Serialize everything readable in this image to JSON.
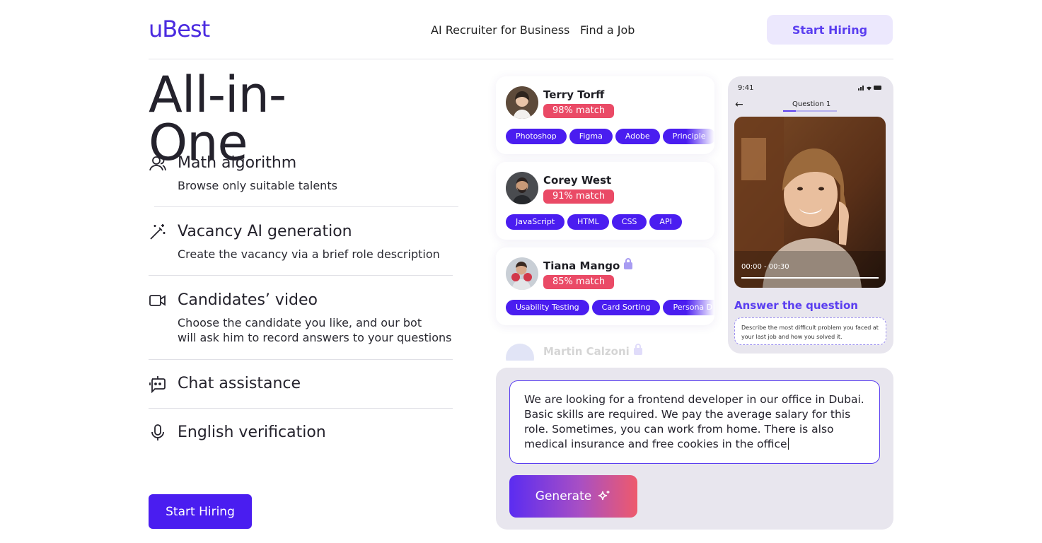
{
  "header": {
    "logo": "uBest",
    "nav": [
      "AI Recruiter for Business",
      "Find a Job"
    ],
    "cta": "Start Hiring"
  },
  "hero": {
    "title": "All-in-One"
  },
  "features": [
    {
      "icon": "user-icon",
      "title": "Math algorithm",
      "desc": [
        "Browse only suitable talents"
      ]
    },
    {
      "icon": "magic-wand-icon",
      "title": "Vacancy AI generation",
      "desc": [
        "Create the vacancy via a brief role description"
      ]
    },
    {
      "icon": "video-camera-icon",
      "title": "Candidates’ video",
      "desc": [
        "Choose the candidate you like, and our bot",
        "will ask him to record answers to your questions"
      ]
    },
    {
      "icon": "chat-bot-icon",
      "title": "Chat assistance",
      "desc": []
    },
    {
      "icon": "microphone-icon",
      "title": "English verification",
      "desc": []
    }
  ],
  "main_cta": "Start Hiring",
  "candidates": [
    {
      "name": "Terry Torff",
      "match": "98% match",
      "locked": false,
      "tags": [
        "Photoshop",
        "Figma",
        "Adobe",
        "Principle"
      ]
    },
    {
      "name": "Corey West",
      "match": "91% match",
      "locked": false,
      "tags": [
        "JavaScript",
        "HTML",
        "CSS",
        "API"
      ]
    },
    {
      "name": "Tiana Mango",
      "match": "85% match",
      "locked": true,
      "tags": [
        "Usability Testing",
        "Card Sorting",
        "Persona D"
      ]
    },
    {
      "name": "Martin Calzoni",
      "locked": true
    }
  ],
  "phone": {
    "time": "9:41",
    "question_label": "Question 1",
    "video_time": "00:00 - 00:30",
    "answer_title": "Answer the question",
    "answer_prompt": "Describe the most difficult problem you faced at your last job and how you solved it."
  },
  "generator": {
    "text": "We are looking for a frontend developer in our office in Dubai. Basic skills are required. We pay the average salary for this role. Sometimes, you can work from home. There is also medical insurance and free cookies in the office",
    "button": "Generate",
    "button_icon": "sparkle-icon"
  },
  "colors": {
    "brand": "#4a1df0",
    "accent_light": "#ece8fd",
    "match": "#ea4a66"
  }
}
